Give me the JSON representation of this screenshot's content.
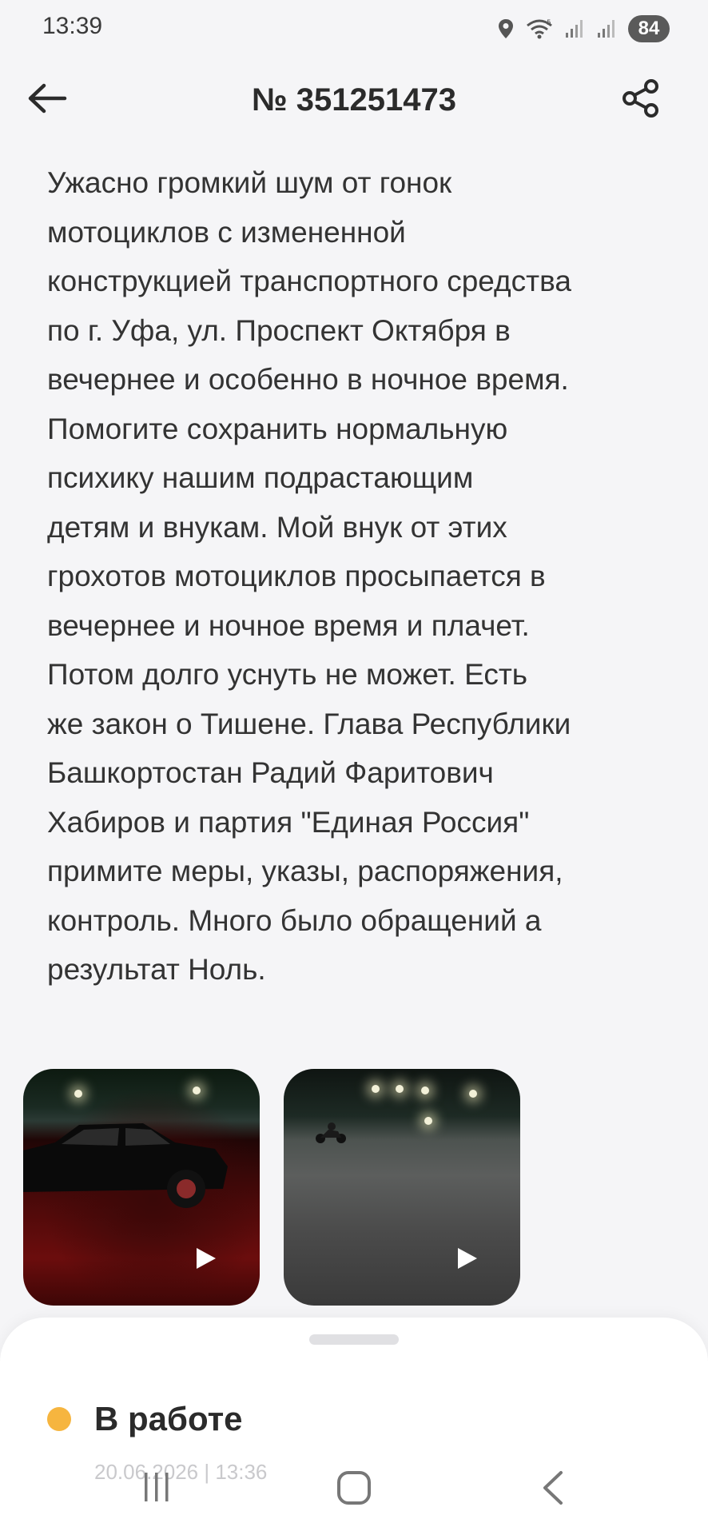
{
  "status_bar": {
    "time": "13:39",
    "battery": "84",
    "icons": [
      "location-icon",
      "wifi-icon",
      "signal-icon",
      "signal-icon",
      "battery-icon"
    ]
  },
  "header": {
    "title": "№ 351251473",
    "back_icon": "arrow-left-icon",
    "share_icon": "share-icon"
  },
  "description": {
    "lines": [
      "Ужасно громкий шум от гонок",
      "мотоциклов с измененной",
      "конструкцией транспортного средства",
      "по г. Уфа, ул. Проспект Октября в",
      "вечернее и особенно в ночное время.",
      "Помогите сохранить нормальную",
      "психику нашим подрастающим",
      "детям и внукам. Мой внук от этих",
      "грохотов мотоциклов просыпается в",
      "вечернее и ночное время и плачет.",
      "Потом долго уснуть не может. Есть",
      "же закон о Тишене. Глава Республики",
      "Башкортостан Радий Фаритович",
      "Хабиров и партия \"Единая Россия\"",
      "примите меры, указы, распоряжения,",
      "контроль. Много было обращений а",
      "результат Ноль."
    ]
  },
  "media": [
    {
      "type": "video",
      "icon": "play-icon"
    },
    {
      "type": "video",
      "icon": "play-icon"
    }
  ],
  "status": {
    "label": "В работе",
    "date": "20.06.2026 | 13:36",
    "color": "#f6b53f"
  },
  "nav": {
    "icons": [
      "recents-icon",
      "home-icon",
      "back-icon"
    ]
  }
}
